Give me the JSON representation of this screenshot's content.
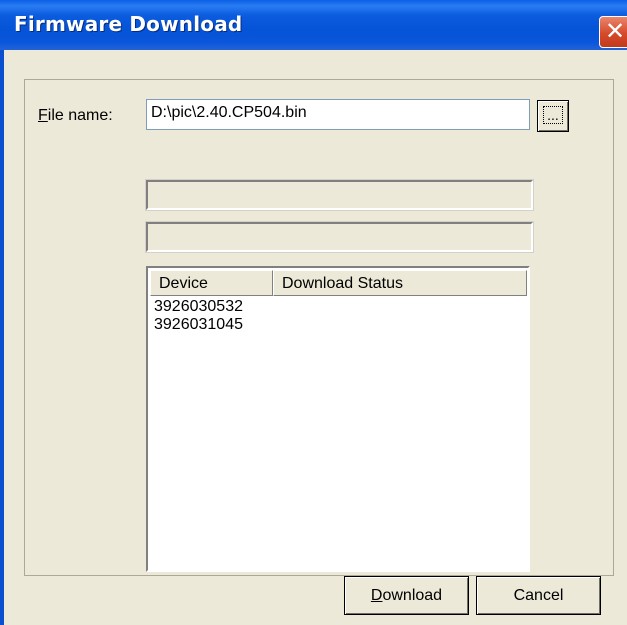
{
  "window": {
    "title": "Firmware Download",
    "close_glyph": "✕"
  },
  "form": {
    "file_label_accel": "F",
    "file_label_rest": "ile name:",
    "file_value": "D:\\pic\\2.40.CP504.bin",
    "browse_label": "..."
  },
  "list": {
    "columns": [
      "Device",
      "Download Status"
    ],
    "rows": [
      {
        "device": "3926030532",
        "status": ""
      },
      {
        "device": "3926031045",
        "status": ""
      }
    ]
  },
  "buttons": {
    "download_accel": "D",
    "download_rest": "ownload",
    "cancel": "Cancel"
  }
}
